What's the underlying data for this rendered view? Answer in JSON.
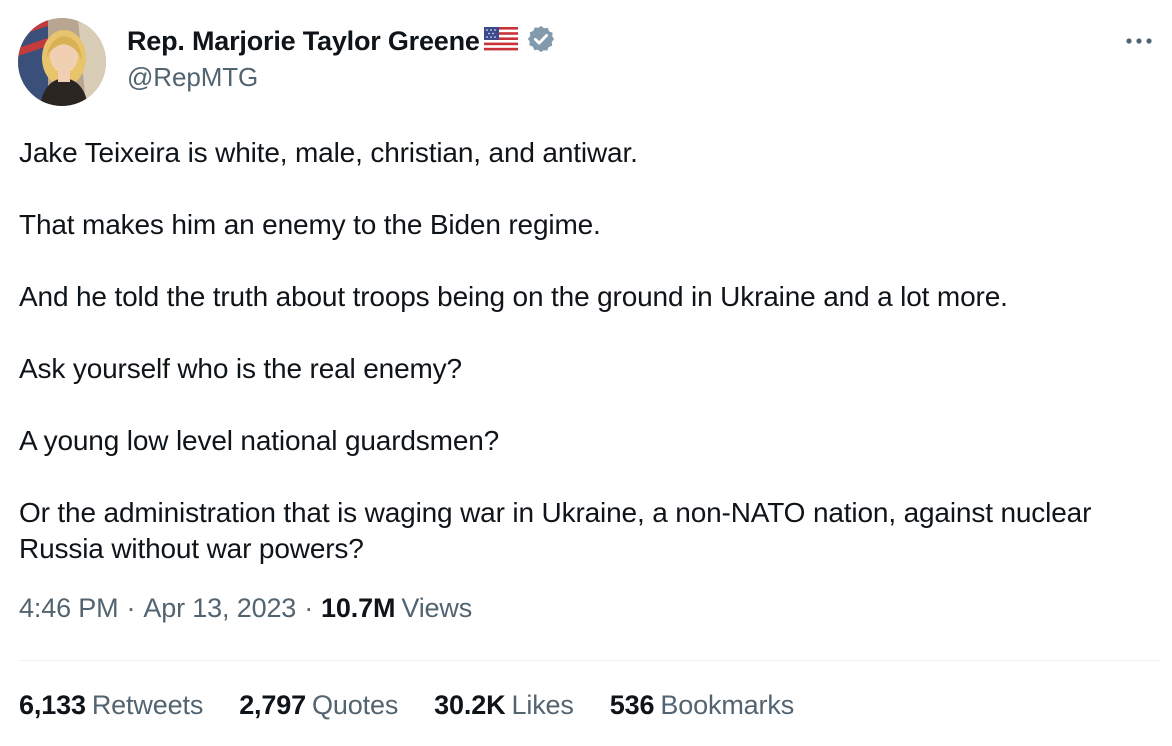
{
  "author": {
    "display_name": "Rep. Marjorie Taylor Greene",
    "flag_icon": "us-flag-icon",
    "verified_icon": "verified-badge-icon",
    "verified_color": "#829aab",
    "handle": "@RepMTG"
  },
  "more_icon": "more-options-icon",
  "tweet": {
    "paragraphs": [
      "Jake Teixeira is white, male, christian, and antiwar.",
      "That makes him an enemy to the Biden regime.",
      "And he told the truth about troops being on the ground in Ukraine and a lot more.",
      "Ask yourself who is the real enemy?",
      "A young low level national guardsmen?",
      "Or the administration that is waging war in Ukraine, a non-NATO nation, against nuclear Russia without war powers?"
    ]
  },
  "meta": {
    "time": "4:46 PM",
    "separator": "·",
    "date": "Apr 13, 2023",
    "views_count": "10.7M",
    "views_label": "Views"
  },
  "stats": {
    "retweets": {
      "count": "6,133",
      "label": "Retweets"
    },
    "quotes": {
      "count": "2,797",
      "label": "Quotes"
    },
    "likes": {
      "count": "30.2K",
      "label": "Likes"
    },
    "bookmarks": {
      "count": "536",
      "label": "Bookmarks"
    }
  },
  "colors": {
    "text_primary": "#0f1419",
    "text_secondary": "#536471",
    "divider": "#eff3f4"
  }
}
